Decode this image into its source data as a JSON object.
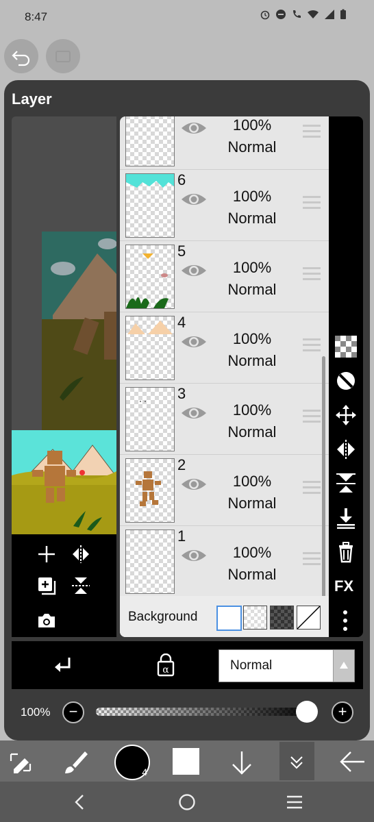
{
  "status": {
    "time": "8:47"
  },
  "panel": {
    "title": "Layer"
  },
  "layers": [
    {
      "name": "",
      "opacity": "100%",
      "blend": "Normal"
    },
    {
      "name": "6",
      "opacity": "100%",
      "blend": "Normal"
    },
    {
      "name": "5",
      "opacity": "100%",
      "blend": "Normal"
    },
    {
      "name": "4",
      "opacity": "100%",
      "blend": "Normal"
    },
    {
      "name": "3",
      "opacity": "100%",
      "blend": "Normal"
    },
    {
      "name": "2",
      "opacity": "100%",
      "blend": "Normal"
    },
    {
      "name": "1",
      "opacity": "100%",
      "blend": "Normal"
    }
  ],
  "background": {
    "label": "Background"
  },
  "right_tools": {
    "fx_label": "FX"
  },
  "blend_select": {
    "value": "Normal"
  },
  "opacity_slider": {
    "label": "100%",
    "value": 1.0
  },
  "toolbar": {
    "brush_size": "4"
  },
  "colors": {
    "accent": "#4a90e2",
    "panel": "#3b3b3b",
    "list_bg": "#e6e6e6"
  }
}
